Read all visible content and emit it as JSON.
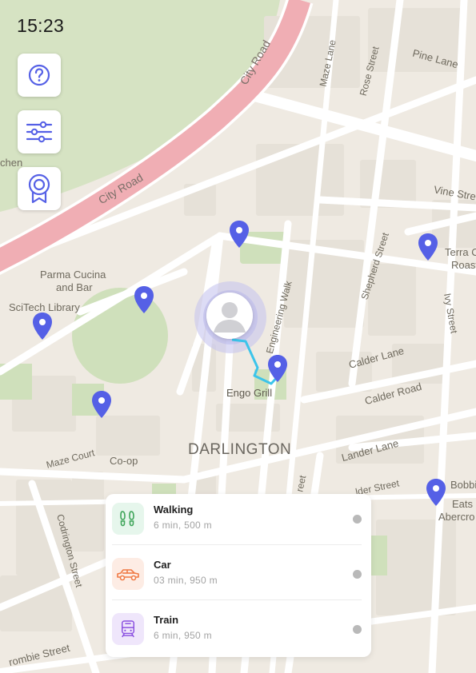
{
  "status": {
    "time": "15:23"
  },
  "map": {
    "labels": {
      "city_road_upper": "City Road",
      "city_road_lower": "City Road",
      "maze_lane": "Maze Lane",
      "rose_street": "Rose Street",
      "pine_lane": "Pine Lane",
      "vine_street": "Vine Stre",
      "kitchen_fragment": "chen",
      "parma_line1": "Parma Cucina",
      "parma_line2": "and Bar",
      "scitech": "SciTech Library",
      "engineering_walk": "Engineering Walk",
      "engo_grill": "Engo Grill",
      "shepherd_street": "Shepherd Street",
      "terra_line1": "Terra C",
      "terra_line2": "Roast",
      "ivy_street": "Ivy Street",
      "calder_lane": "Calder Lane",
      "calder_road": "Calder Road",
      "lander_lane": "Lander Lane",
      "darlington": "DARLINGTON",
      "maze_court": "Maze Court",
      "coop": "Co-op",
      "elder_street": "lder Street",
      "street_fragment": "reet",
      "bobbi": "Bobbi",
      "eats": "Eats",
      "abercro": "Abercro",
      "codrington": "Codrington Street",
      "combie": "rombie Street"
    },
    "colors": {
      "pin": "#5560e6",
      "route": "#3cc4ea",
      "major_road": "#f0aeb4",
      "park": "#cfe0bb"
    }
  },
  "toolbar": [
    {
      "icon": "help-circle-icon"
    },
    {
      "icon": "sliders-icon"
    },
    {
      "icon": "award-badge-icon"
    }
  ],
  "routes": [
    {
      "mode": "Walking",
      "detail": "6 min, 500 m",
      "icon": "footsteps-icon",
      "icon_bg": "#e6f6ec",
      "icon_color": "#3fa55a"
    },
    {
      "mode": "Car",
      "detail": "03 min, 950 m",
      "icon": "car-icon",
      "icon_bg": "#fdece4",
      "icon_color": "#f07a45"
    },
    {
      "mode": "Train",
      "detail": "6 min, 950 m",
      "icon": "train-icon",
      "icon_bg": "#efe6fb",
      "icon_color": "#8a4fe0"
    }
  ]
}
